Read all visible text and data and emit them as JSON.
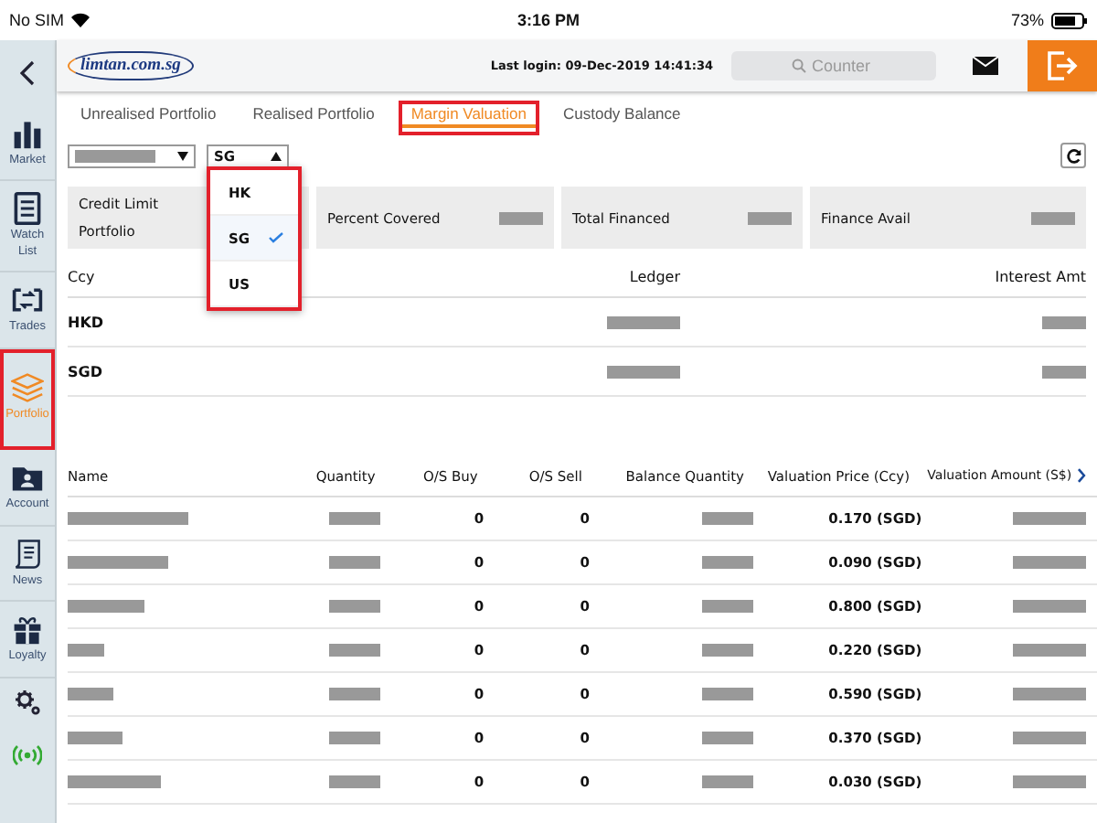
{
  "status_bar": {
    "carrier": "No SIM",
    "time": "3:16 PM",
    "battery": "73%"
  },
  "header": {
    "logo": "limtan.com.sg",
    "last_login": "Last login: 09-Dec-2019 14:41:34",
    "search": {
      "placeholder": "Counter"
    }
  },
  "sidebar": {
    "items": [
      {
        "kind": "chart",
        "label": "Market",
        "selected": false,
        "highlighted": false
      },
      {
        "kind": "list",
        "label": "Watch List",
        "selected": false,
        "highlighted": false
      },
      {
        "kind": "trades",
        "label": "Trades",
        "selected": false,
        "highlighted": false
      },
      {
        "kind": "layers",
        "label": "Portfolio",
        "selected": true,
        "highlighted": true
      },
      {
        "kind": "folder",
        "label": "Account",
        "selected": false,
        "highlighted": false
      },
      {
        "kind": "news",
        "label": "News",
        "selected": false,
        "highlighted": false
      },
      {
        "kind": "gift",
        "label": "Loyalty",
        "selected": false,
        "highlighted": false
      }
    ]
  },
  "tabs": [
    {
      "label": "Unrealised Portfolio",
      "selected": false,
      "highlighted": false
    },
    {
      "label": "Realised Portfolio",
      "selected": false,
      "highlighted": false
    },
    {
      "label": "Margin Valuation",
      "selected": true,
      "highlighted": true
    },
    {
      "label": "Custody Balance",
      "selected": false,
      "highlighted": false
    }
  ],
  "market_select": {
    "value": "SG",
    "expanded": true,
    "highlighted": true,
    "options": [
      {
        "label": "HK",
        "selected": false
      },
      {
        "label": "SG",
        "selected": true
      },
      {
        "label": "US",
        "selected": false
      }
    ]
  },
  "summary": [
    {
      "labels": [
        "Credit Limit",
        "Portfolio"
      ]
    },
    {
      "labels": [
        "Percent Covered"
      ]
    },
    {
      "labels": [
        "Total Financed"
      ]
    },
    {
      "labels": [
        "Finance Avail"
      ]
    }
  ],
  "balances": {
    "columns": [
      "Ccy",
      "Ledger",
      "Interest Amt"
    ],
    "rows": [
      {
        "ccy": "HKD"
      },
      {
        "ccy": "SGD"
      }
    ]
  },
  "holdings": {
    "columns": [
      "Name",
      "Quantity",
      "O/S Buy",
      "O/S Sell",
      "Balance Quantity",
      "Valuation Price (Ccy)",
      "Valuation Amount (S$)"
    ],
    "rows": [
      {
        "os_buy": "0",
        "os_sell": "0",
        "valuation_price": "0.170 (SGD)"
      },
      {
        "os_buy": "0",
        "os_sell": "0",
        "valuation_price": "0.090 (SGD)"
      },
      {
        "os_buy": "0",
        "os_sell": "0",
        "valuation_price": "0.800 (SGD)"
      },
      {
        "os_buy": "0",
        "os_sell": "0",
        "valuation_price": "0.220 (SGD)"
      },
      {
        "os_buy": "0",
        "os_sell": "0",
        "valuation_price": "0.590 (SGD)"
      },
      {
        "os_buy": "0",
        "os_sell": "0",
        "valuation_price": "0.370 (SGD)"
      },
      {
        "os_buy": "0",
        "os_sell": "0",
        "valuation_price": "0.030 (SGD)"
      }
    ]
  }
}
